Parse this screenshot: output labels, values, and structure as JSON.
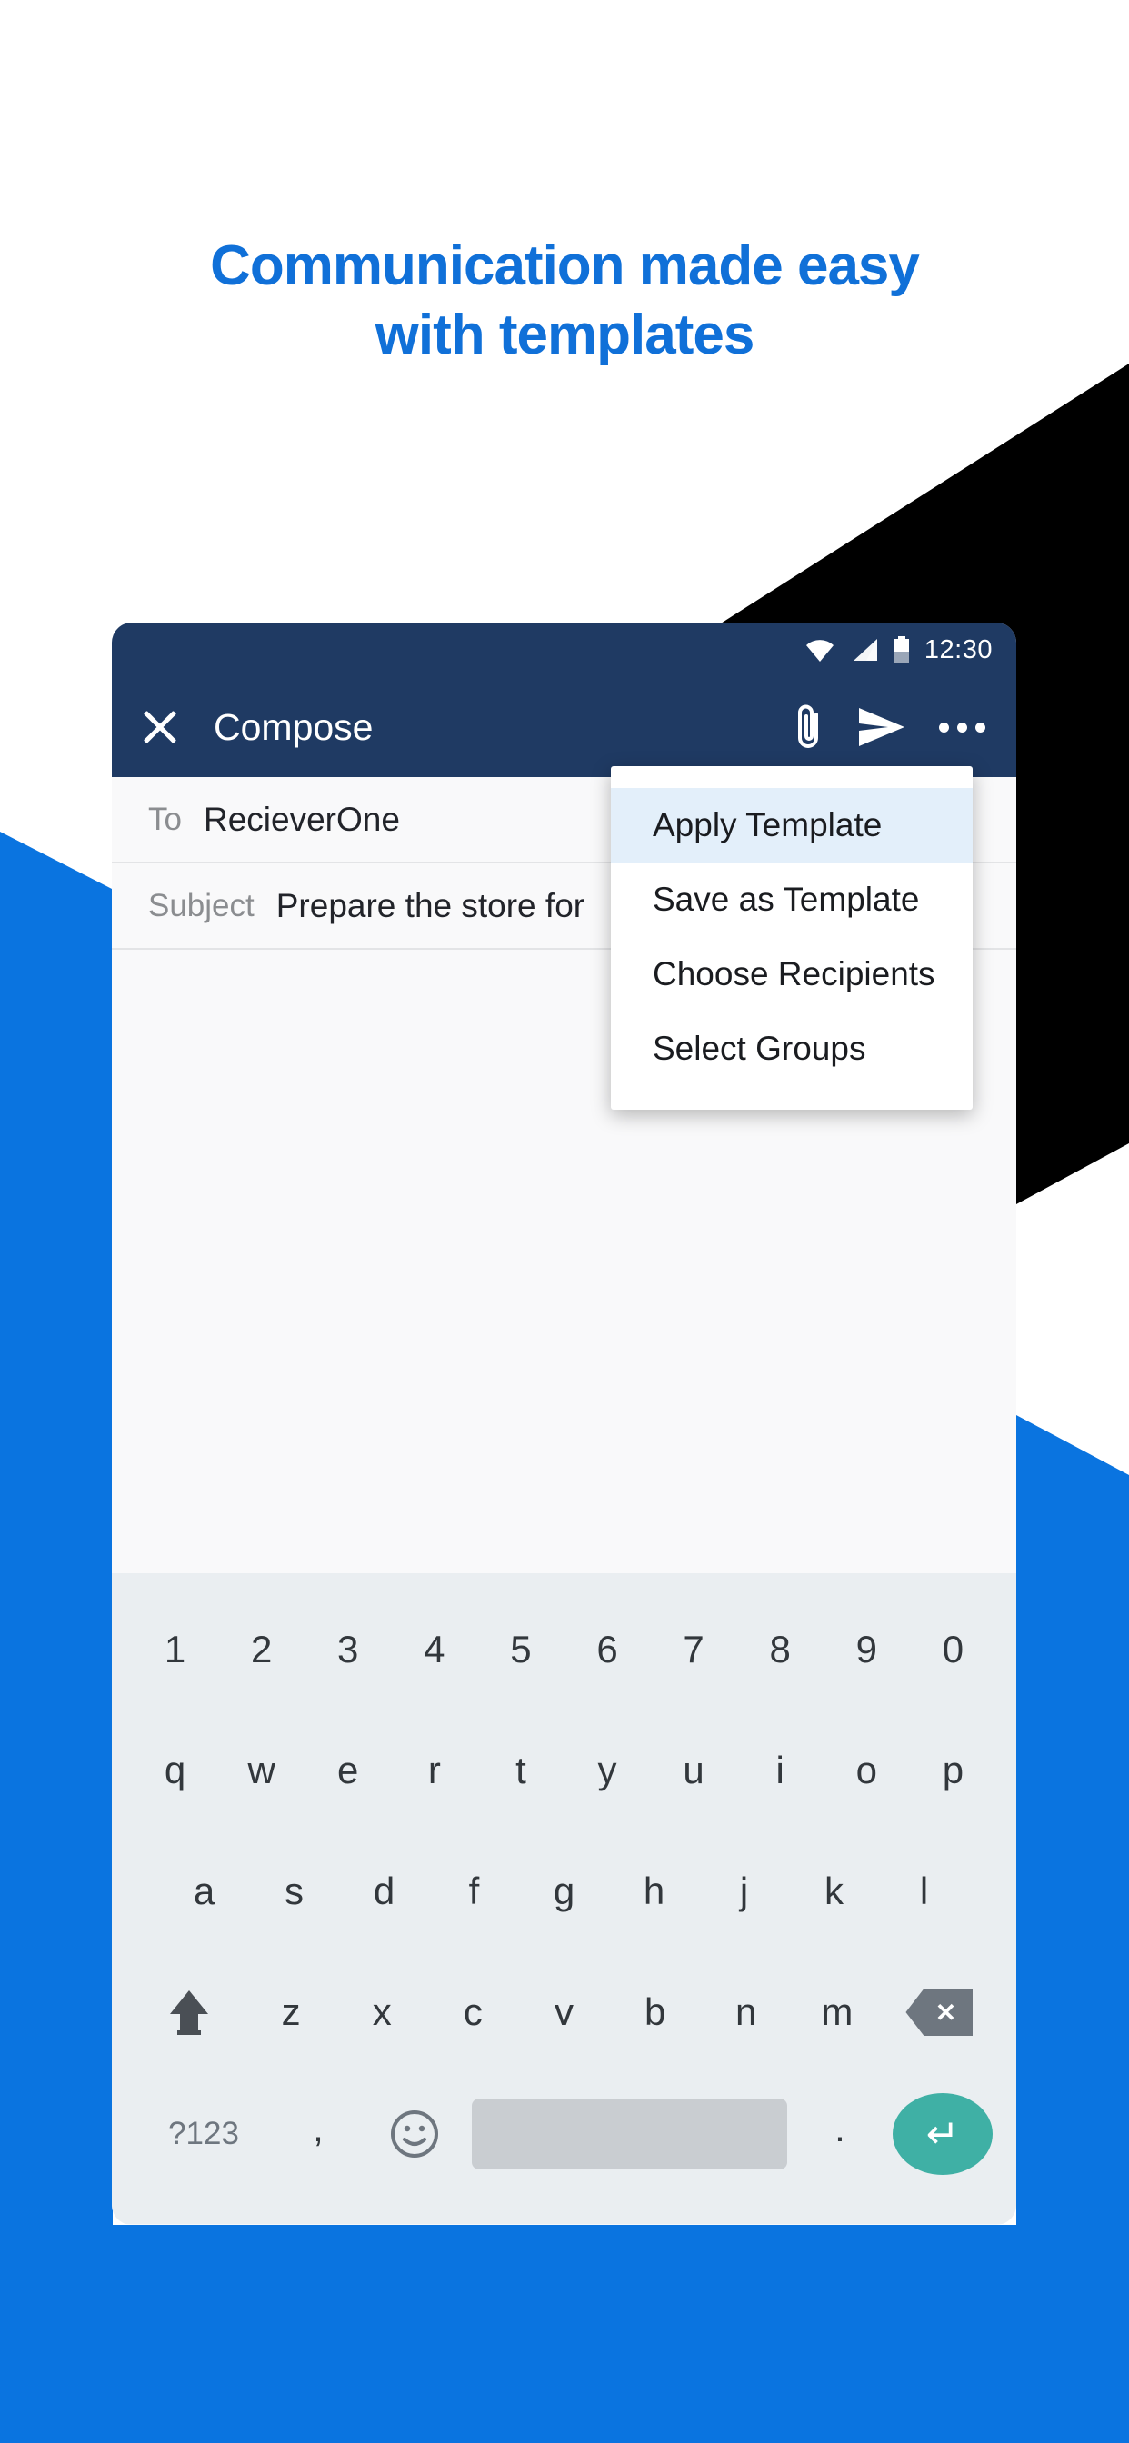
{
  "headline": {
    "line1": "Communication made easy",
    "line2": "with templates",
    "color": "#1070d8"
  },
  "colors": {
    "brand_blue": "#0a74e0",
    "appbar_navy": "#1f3a63",
    "menu_highlight": "#e3effa",
    "enter_key_teal": "#3fb0a5",
    "black_shape": "#000000"
  },
  "phone": {
    "status_bar": {
      "time": "12:30",
      "icons": [
        "wifi-icon",
        "cellular-signal-icon",
        "battery-icon"
      ]
    },
    "app_bar": {
      "close_icon": "close-x-icon",
      "title": "Compose",
      "attach_icon": "paperclip-icon",
      "send_icon": "send-arrow-icon",
      "overflow_icon": "overflow-menu-icon"
    },
    "fields": [
      {
        "label": "To",
        "value": "RecieverOne"
      },
      {
        "label": "Subject",
        "value": "Prepare the store for"
      }
    ],
    "body_text": ""
  },
  "dropdown_menu": {
    "items": [
      {
        "label": "Apply Template",
        "selected": true
      },
      {
        "label": "Save as Template",
        "selected": false
      },
      {
        "label": "Choose Recipients",
        "selected": false
      },
      {
        "label": "Select Groups",
        "selected": false
      }
    ]
  },
  "keyboard": {
    "row_numbers": [
      "1",
      "2",
      "3",
      "4",
      "5",
      "6",
      "7",
      "8",
      "9",
      "0"
    ],
    "row_qwerty": [
      "q",
      "w",
      "e",
      "r",
      "t",
      "y",
      "u",
      "i",
      "o",
      "p"
    ],
    "row_asdf": [
      "a",
      "s",
      "d",
      "f",
      "g",
      "h",
      "j",
      "k",
      "l"
    ],
    "row_zxcv": [
      "z",
      "x",
      "c",
      "v",
      "b",
      "n",
      "m"
    ],
    "shift_key": "shift-icon",
    "backspace_key": "backspace-icon",
    "num_symbols_key": "?123",
    "comma_key": ",",
    "emoji_key": "emoji-smiley-icon",
    "space_key": "",
    "period_key": ".",
    "enter_key": "↵"
  }
}
